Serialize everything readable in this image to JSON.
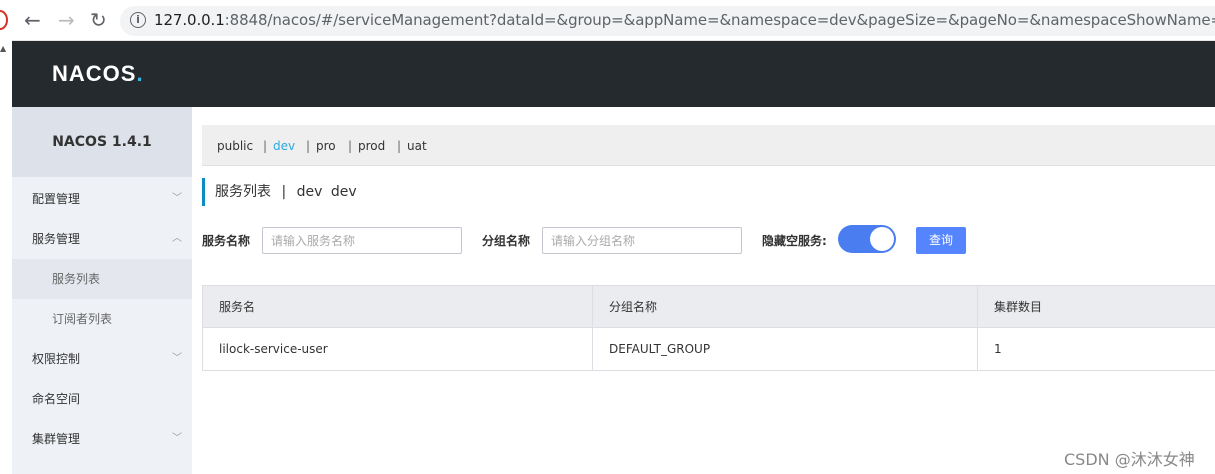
{
  "browser": {
    "url_host": "127.0.0.1",
    "url_rest": ":8848/nacos/#/serviceManagement?dataId=&group=&appName=&namespace=dev&pageSize=&pageNo=&namespaceShowName=dev"
  },
  "header": {
    "logo": "NACOS",
    "logo_dot": "."
  },
  "sidebar": {
    "title": "NACOS 1.4.1",
    "items": [
      {
        "label": "配置管理"
      },
      {
        "label": "服务管理"
      },
      {
        "label": "服务列表"
      },
      {
        "label": "订阅者列表"
      },
      {
        "label": "权限控制"
      },
      {
        "label": "命名空间"
      },
      {
        "label": "集群管理"
      }
    ]
  },
  "namespaces": [
    {
      "label": "public"
    },
    {
      "label": "dev"
    },
    {
      "label": "pro"
    },
    {
      "label": "prod"
    },
    {
      "label": "uat"
    }
  ],
  "page": {
    "title": "服务列表",
    "separator": "|",
    "namespace_name": "dev",
    "namespace_id": "dev"
  },
  "search": {
    "service_name_label": "服务名称",
    "service_name_placeholder": "请输入服务名称",
    "group_name_label": "分组名称",
    "group_name_placeholder": "请输入分组名称",
    "hide_empty_label": "隐藏空服务:",
    "query_button": "查询"
  },
  "table": {
    "columns": [
      "服务名",
      "分组名称",
      "集群数目"
    ],
    "rows": [
      [
        "lilock-service-user",
        "DEFAULT_GROUP",
        "1"
      ]
    ]
  },
  "watermark": "CSDN @沐沐女神",
  "colors": {
    "accent": "#5584ff",
    "header_bg": "#252a2f",
    "active_ns": "#2ea8e0",
    "toggle_on": "#4a7ef0"
  }
}
